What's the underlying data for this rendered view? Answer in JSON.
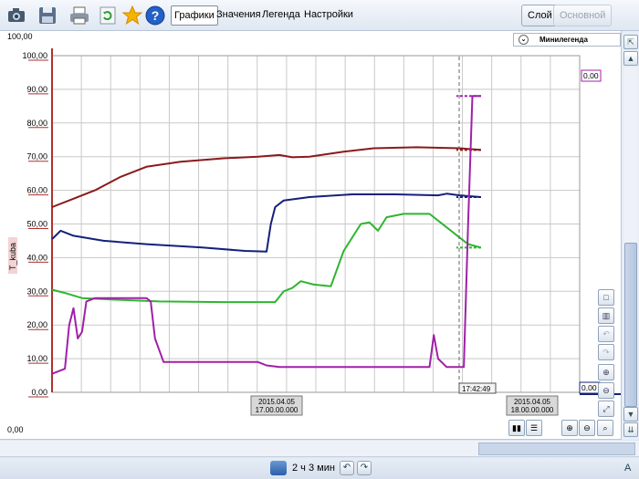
{
  "toolbar": {
    "icons": [
      "camera-icon",
      "save-icon",
      "print-icon",
      "refresh-icon",
      "star-icon",
      "help-icon"
    ],
    "tabs": [
      "Графики",
      "Значения",
      "Легенда",
      "Настройки"
    ],
    "active_tab": "Графики",
    "mode_buttons": [
      "Слой",
      "Основной"
    ]
  },
  "chart_header": {
    "max_label": "100,00",
    "minilegend_label": "Минилегенда"
  },
  "bottom_left_value": "0,00",
  "cursor": {
    "time_label": "17:42:49",
    "right_value_top": "0,00",
    "right_value_bottom": "0,00"
  },
  "x_ticks": [
    {
      "date": "2015.04.05",
      "time": "17.00.00.000"
    },
    {
      "date": "2015.04.05",
      "time": "18.00.00.000"
    }
  ],
  "status": {
    "period": "2 ч 3 мин",
    "lang": "A"
  },
  "colors": {
    "dark_red": "#8b1a1a",
    "navy": "#13217a",
    "green": "#2fb52f",
    "purple": "#a020a8",
    "axis_red": "#b03030"
  },
  "chart_data": {
    "type": "line",
    "ylabel": "T_kuba",
    "ylim": [
      0,
      100
    ],
    "y_ticks": [
      "0,00",
      "10,00",
      "20,00",
      "30,00",
      "40,00",
      "50,00",
      "60,00",
      "70,00",
      "80,00",
      "90,00",
      "100,00"
    ],
    "x_unit": "minutes from 16:38",
    "xlim": [
      0,
      123
    ],
    "series": [
      {
        "color": "dark_red",
        "points": [
          [
            0,
            55
          ],
          [
            5,
            57.5
          ],
          [
            10,
            60
          ],
          [
            16,
            64
          ],
          [
            22,
            67
          ],
          [
            30,
            68.5
          ],
          [
            40,
            69.5
          ],
          [
            48,
            70
          ],
          [
            53,
            70.5
          ],
          [
            56,
            69.8
          ],
          [
            60,
            70
          ],
          [
            68,
            71.5
          ],
          [
            75,
            72.5
          ],
          [
            85,
            72.8
          ],
          [
            95,
            72.5
          ],
          [
            100,
            72
          ]
        ]
      },
      {
        "color": "navy",
        "points": [
          [
            0,
            45.5
          ],
          [
            2,
            48
          ],
          [
            5,
            46.5
          ],
          [
            12,
            45
          ],
          [
            22,
            44
          ],
          [
            35,
            43
          ],
          [
            45,
            42
          ],
          [
            50,
            41.8
          ],
          [
            51,
            50
          ],
          [
            52,
            55
          ],
          [
            54,
            57
          ],
          [
            60,
            58
          ],
          [
            70,
            58.8
          ],
          [
            80,
            58.8
          ],
          [
            90,
            58.5
          ],
          [
            92,
            59
          ],
          [
            95,
            58.5
          ],
          [
            100,
            58
          ]
        ]
      },
      {
        "color": "green",
        "points": [
          [
            0,
            30.5
          ],
          [
            3,
            29.5
          ],
          [
            7,
            28
          ],
          [
            15,
            27.5
          ],
          [
            25,
            27
          ],
          [
            40,
            26.8
          ],
          [
            52,
            26.8
          ],
          [
            54,
            30
          ],
          [
            56,
            31
          ],
          [
            58,
            33
          ],
          [
            61,
            32
          ],
          [
            65,
            31.5
          ],
          [
            68,
            42
          ],
          [
            72,
            50
          ],
          [
            74,
            50.5
          ],
          [
            76,
            48
          ],
          [
            78,
            52
          ],
          [
            82,
            53
          ],
          [
            88,
            53
          ],
          [
            92,
            49
          ],
          [
            95,
            46
          ],
          [
            97,
            44
          ],
          [
            100,
            43
          ]
        ]
      },
      {
        "color": "purple",
        "points": [
          [
            0,
            5.5
          ],
          [
            3,
            7
          ],
          [
            4,
            20
          ],
          [
            5,
            25
          ],
          [
            6,
            16
          ],
          [
            7,
            18
          ],
          [
            8,
            27
          ],
          [
            10,
            28
          ],
          [
            22,
            28
          ],
          [
            23,
            27
          ],
          [
            24,
            16
          ],
          [
            26,
            9
          ],
          [
            30,
            9
          ],
          [
            40,
            9
          ],
          [
            48,
            9
          ],
          [
            50,
            8
          ],
          [
            53,
            7.5
          ],
          [
            60,
            7.5
          ],
          [
            70,
            7.5
          ],
          [
            80,
            7.5
          ],
          [
            88,
            7.5
          ],
          [
            89,
            17
          ],
          [
            90,
            10
          ],
          [
            92,
            7.5
          ],
          [
            96,
            7.5
          ],
          [
            97,
            50
          ],
          [
            98,
            88
          ],
          [
            100,
            88
          ]
        ]
      }
    ]
  }
}
